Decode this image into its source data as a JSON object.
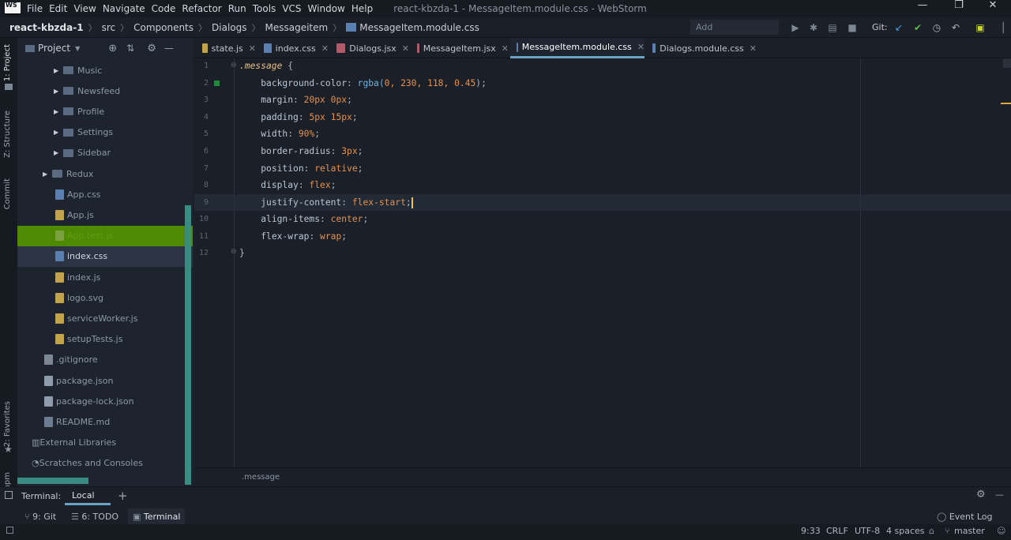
{
  "app": {
    "logo_text": "WS",
    "menu": [
      "File",
      "Edit",
      "View",
      "Navigate",
      "Code",
      "Refactor",
      "Run",
      "Tools",
      "VCS",
      "Window",
      "Help"
    ],
    "window_title": "react-kbzda-1 - MessageItem.module.css - WebStorm",
    "window_controls": {
      "minimize": "—",
      "restore": "❐",
      "close": "✕"
    }
  },
  "navbar": {
    "breadcrumbs": [
      "react-kbzda-1",
      "src",
      "Components",
      "Dialogs",
      "Messageitem",
      "MessageItem.module.css"
    ],
    "add_configuration": "Add Configuration...",
    "git_label": "Git:"
  },
  "left_stripe": {
    "labels": [
      "1: Project",
      "Z: Structure",
      "Commit",
      "2: Favorites",
      "npm"
    ]
  },
  "project": {
    "title": "Project",
    "tree": [
      {
        "label": "Music",
        "kind": "folder",
        "indent": 2,
        "collapsed": true
      },
      {
        "label": "Newsfeed",
        "kind": "folder",
        "indent": 2,
        "collapsed": true
      },
      {
        "label": "Profile",
        "kind": "folder",
        "indent": 2,
        "collapsed": true
      },
      {
        "label": "Settings",
        "kind": "folder",
        "indent": 2,
        "collapsed": true
      },
      {
        "label": "Sidebar",
        "kind": "folder",
        "indent": 2,
        "collapsed": true
      },
      {
        "label": "Redux",
        "kind": "folder",
        "indent": 1,
        "collapsed": true
      },
      {
        "label": "App.css",
        "kind": "css",
        "indent": 2
      },
      {
        "label": "App.js",
        "kind": "js",
        "indent": 2
      },
      {
        "label": "App.test.js",
        "kind": "test",
        "indent": 2,
        "state": "highlighted"
      },
      {
        "label": "index.css",
        "kind": "css",
        "indent": 2,
        "state": "selected"
      },
      {
        "label": "index.js",
        "kind": "js",
        "indent": 2
      },
      {
        "label": "logo.svg",
        "kind": "svg",
        "indent": 2
      },
      {
        "label": "serviceWorker.js",
        "kind": "js",
        "indent": 2
      },
      {
        "label": "setupTests.js",
        "kind": "js",
        "indent": 2
      },
      {
        "label": ".gitignore",
        "kind": "file",
        "indent": 1
      },
      {
        "label": "package.json",
        "kind": "json",
        "indent": 1
      },
      {
        "label": "package-lock.json",
        "kind": "json",
        "indent": 1
      },
      {
        "label": "README.md",
        "kind": "md",
        "indent": 1
      },
      {
        "label": "External Libraries",
        "kind": "lib",
        "indent": 0
      },
      {
        "label": "Scratches and Consoles",
        "kind": "scratch",
        "indent": 0
      }
    ]
  },
  "tabs": [
    {
      "label": "state.js",
      "type": "js",
      "active": false
    },
    {
      "label": "index.css",
      "type": "css",
      "active": false
    },
    {
      "label": "Dialogs.jsx",
      "type": "jsx",
      "active": false
    },
    {
      "label": "MessageItem.jsx",
      "type": "jsx",
      "active": false
    },
    {
      "label": "MessageItem.module.css",
      "type": "css",
      "active": true
    },
    {
      "label": "Dialogs.module.css",
      "type": "css",
      "active": false
    }
  ],
  "editor": {
    "line_numbers": [
      "1",
      "2",
      "3",
      "4",
      "5",
      "6",
      "7",
      "8",
      "9",
      "10",
      "11",
      "12"
    ],
    "lines": [
      {
        "selector": ".message",
        "brace": " {"
      },
      {
        "prop": "background-color",
        "fn": "rgba(",
        "args": "0, 230, 118, 0.45",
        "end": ");"
      },
      {
        "prop": "margin",
        "val": "20px 0px",
        "end": ";"
      },
      {
        "prop": "padding",
        "val": "5px 15px",
        "end": ";"
      },
      {
        "prop": "width",
        "val": "90%",
        "end": ";"
      },
      {
        "prop": "border-radius",
        "val": "3px",
        "end": ";"
      },
      {
        "prop": "position",
        "val": "relative",
        "end": ";"
      },
      {
        "prop": "display",
        "val": "flex",
        "end": ";"
      },
      {
        "prop": "justify-content",
        "val": "flex-start",
        "end": ";"
      },
      {
        "prop": "align-items",
        "val": "center",
        "end": ";"
      },
      {
        "prop": "flex-wrap",
        "val": "wrap",
        "end": ";"
      },
      {
        "brace": "}"
      }
    ],
    "footer_crumb": ".message"
  },
  "terminal": {
    "label": "Terminal:",
    "tab": "Local",
    "add": "+"
  },
  "tool_windows": [
    {
      "label": "9: Git",
      "icon": "git-branch-icon"
    },
    {
      "label": "6: TODO",
      "icon": "list-icon"
    },
    {
      "label": "Terminal",
      "icon": "terminal-icon"
    }
  ],
  "event_log": "Event Log",
  "status": {
    "position": "9:33",
    "line_sep": "CRLF",
    "encoding": "UTF-8",
    "indent": "4 spaces",
    "branch": "master"
  },
  "colors": {
    "accent": "#6aa2c6",
    "selection_green": "#4e8a03",
    "scroll_teal": "#3a8c83",
    "caret": "#f0c44a"
  }
}
